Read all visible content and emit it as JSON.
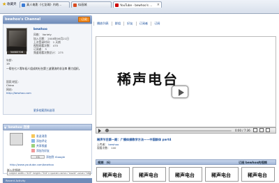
{
  "browser": {
    "favorites_label": "收藏夹",
    "tabs": [
      {
        "title": "真人电影《七龙珠》内地…",
        "active": false
      },
      {
        "title": "似画城",
        "active": false
      },
      {
        "title": "YouTube - bewhoo's …",
        "active": true
      }
    ]
  },
  "topnav": [
    "视频",
    "收藏夹",
    "播放列表",
    "群组",
    "好友",
    "订阅者",
    "订阅"
  ],
  "channel": {
    "header": "bewhoo's Channel",
    "subscribe": "订阅",
    "username": "bewhoo",
    "video_count": "54683706",
    "style": "风格： Variety",
    "joined": "加入日期： 2008年06月21日",
    "last_login": "上次登录时间： 1 天前",
    "views": "视频观看次数： 470",
    "subscribers": "订阅者： 3",
    "channel_views": "频道观看次数总计： 273",
    "age_label": "年龄:",
    "age": "19",
    "about": "一帮在七八零年轻人组成的社台第三波潮流的非法串 暴力组织。",
    "country_label": "国家/地区:",
    "country": "China",
    "website_label": "网站:",
    "website": "http://bewhoo.com",
    "more_link": "更多档案资料选项"
  },
  "connect": {
    "header": "bewhoo 连接",
    "links": [
      "发送消息",
      "添加评论",
      "共享频道",
      "添加为好友"
    ],
    "google": "添加到 iGoogle",
    "url": "http://www.youtube.com/bewhoo",
    "embed_label": "嵌入此频道：",
    "embed_code": "<object width=\"425\" height=\"344\"><param name=\"movie\" value=\"http://www.youtube.com/swf/cl.swf",
    "bottom": "Recent Activity"
  },
  "video": {
    "title_text": "稀声电台",
    "timer": "0:00 / 7:36",
    "progress": 0.0
  },
  "info": {
    "title": "稀声节目第一期：广播体操教学方法——中国群体 part4",
    "uploader_label": "上传者：",
    "uploader": "bewhoo",
    "views": "观看次数： 100"
  },
  "list": {
    "left": "视频 （6）",
    "right": "订阅 bewhoo的视频",
    "thumbs": [
      "稀声电台",
      "稀声电台",
      "稀声电台",
      "稀声电台",
      "稀声电台"
    ]
  }
}
